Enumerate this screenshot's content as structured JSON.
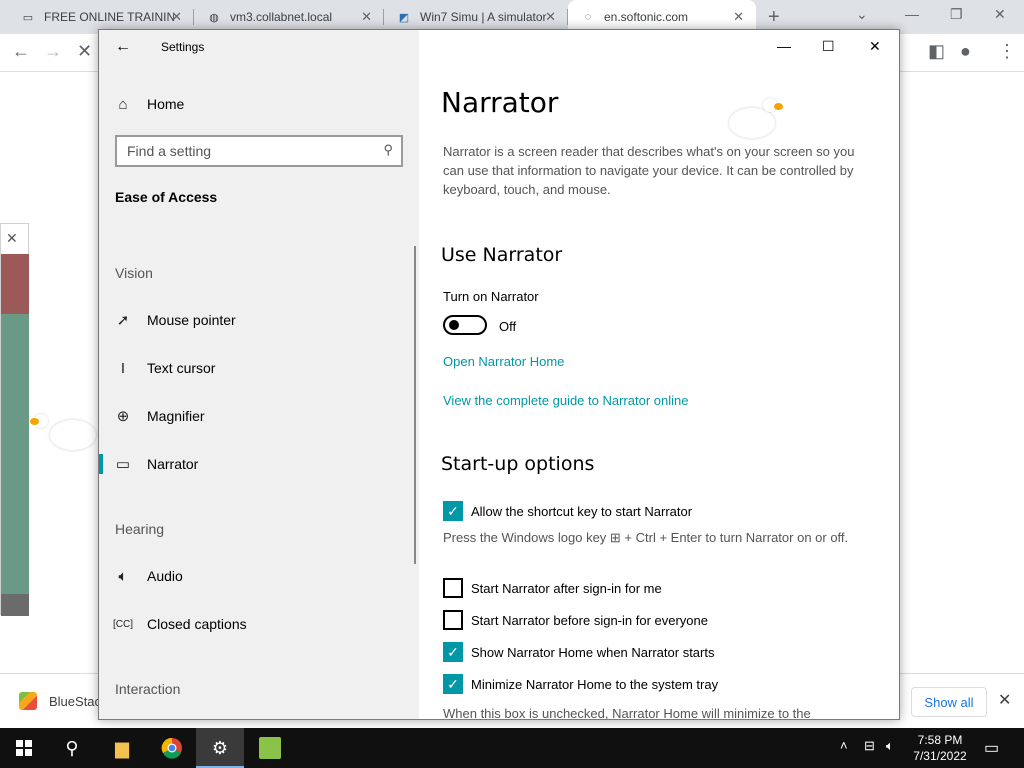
{
  "browser": {
    "tabs": [
      {
        "title": "FREE ONLINE TRAINING",
        "favicon": "training-icon"
      },
      {
        "title": "vm3.collabnet.local",
        "favicon": "globe-icon"
      },
      {
        "title": "Win7 Simu | A simulator",
        "favicon": "win7-icon"
      },
      {
        "title": "en.softonic.com",
        "favicon": "loading-icon",
        "active": true
      }
    ],
    "download": {
      "filename": "BlueStac",
      "show_all": "Show all"
    }
  },
  "settings": {
    "window_title": "Settings",
    "nav": {
      "home": "Home",
      "search_placeholder": "Find a setting",
      "category": "Ease of Access",
      "groups": {
        "vision": "Vision",
        "hearing": "Hearing",
        "interaction": "Interaction"
      },
      "items": {
        "mouse_pointer": "Mouse pointer",
        "text_cursor": "Text cursor",
        "magnifier": "Magnifier",
        "narrator": "Narrator",
        "audio": "Audio",
        "closed_captions": "Closed captions"
      }
    },
    "main": {
      "title": "Narrator",
      "description": "Narrator is a screen reader that describes what's on your screen so you can use that information to navigate your device. It can be controlled by keyboard, touch, and mouse.",
      "use_narrator": {
        "heading": "Use Narrator",
        "turn_on_label": "Turn on Narrator",
        "toggle_state": "Off",
        "link_home": "Open Narrator Home",
        "link_guide": "View the complete guide to Narrator online"
      },
      "startup": {
        "heading": "Start-up options",
        "opt_shortcut": "Allow the shortcut key to start Narrator",
        "shortcut_note": "Press the Windows logo key ⊞ + Ctrl + Enter to turn Narrator on or off.",
        "opt_after_signin": "Start Narrator after sign-in for me",
        "opt_before_signin": "Start Narrator before sign-in for everyone",
        "opt_show_home": "Show Narrator Home when Narrator starts",
        "opt_minimize": "Minimize Narrator Home to the system tray",
        "minimize_note": "When this box is unchecked, Narrator Home will minimize to the"
      }
    }
  },
  "taskbar": {
    "time": "7:58 PM",
    "date": "7/31/2022"
  }
}
